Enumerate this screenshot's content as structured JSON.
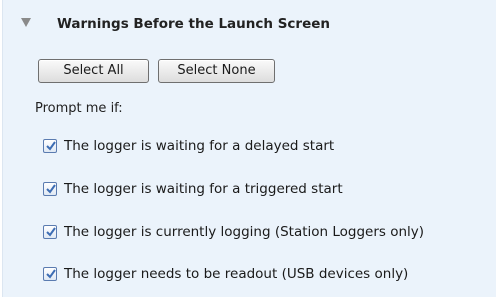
{
  "section": {
    "title": "Warnings Before the Launch Screen",
    "expanded": true
  },
  "buttons": {
    "select_all": "Select All",
    "select_none": "Select None"
  },
  "prompt_label": "Prompt me if:",
  "options": [
    {
      "label": "The logger is waiting for a delayed start",
      "checked": true
    },
    {
      "label": "The logger is waiting for a triggered start",
      "checked": true
    },
    {
      "label": "The logger is currently logging (Station Loggers only)",
      "checked": true
    },
    {
      "label": "The logger needs to be readout (USB devices only)",
      "checked": true
    }
  ],
  "colors": {
    "panel_background": "#ebf3fb",
    "checkmark": "#3d6db4"
  }
}
